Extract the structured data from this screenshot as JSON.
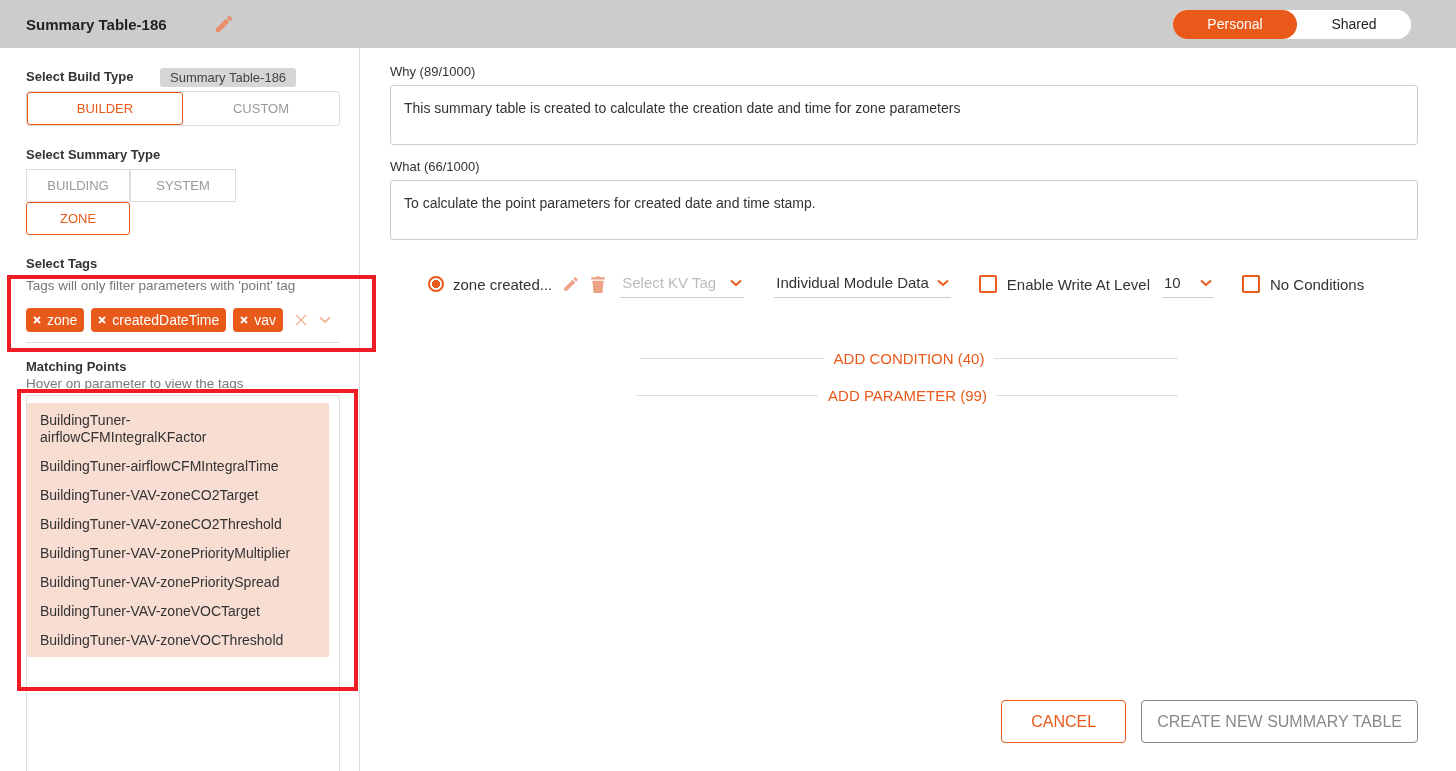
{
  "header": {
    "title": "Summary Table-186",
    "toggle": [
      {
        "label": "Personal",
        "selected": true
      },
      {
        "label": "Shared",
        "selected": false
      }
    ]
  },
  "tooltip": "Summary Table-186",
  "build_type": {
    "label": "Select Build Type",
    "options": [
      {
        "label": "BUILDER",
        "selected": true
      },
      {
        "label": "CUSTOM",
        "selected": false
      }
    ]
  },
  "summary_type": {
    "label": "Select Summary Type",
    "options": [
      {
        "label": "BUILDING",
        "selected": false
      },
      {
        "label": "SYSTEM",
        "selected": false
      },
      {
        "label": "ZONE",
        "selected": true
      }
    ]
  },
  "tags": {
    "label": "Select Tags",
    "hint": "Tags will only filter parameters with 'point' tag",
    "chips": [
      "zone",
      "createdDateTime",
      "vav"
    ],
    "highlighted": true
  },
  "matching": {
    "label": "Matching Points",
    "hint": "Hover on parameter to view the tags",
    "highlighted": true,
    "points": [
      "BuildingTuner-airflowCFMIntegralKFactor",
      "BuildingTuner-airflowCFMIntegralTime",
      "BuildingTuner-VAV-zoneCO2Target",
      "BuildingTuner-VAV-zoneCO2Threshold",
      "BuildingTuner-VAV-zonePriorityMultiplier",
      "BuildingTuner-VAV-zonePrioritySpread",
      "BuildingTuner-VAV-zoneVOCTarget",
      "BuildingTuner-VAV-zoneVOCThreshold"
    ]
  },
  "why": {
    "label": "Why (89/1000)",
    "value": "This summary table is created to calculate the creation date and time for zone parameters"
  },
  "what": {
    "label": "What (66/1000)",
    "value": "To calculate the point parameters for created date and time stamp."
  },
  "parameter": {
    "selected": true,
    "name": "zone created...",
    "kv_placeholder": "Select KV Tag",
    "data_type": "Individual Module Data",
    "enable_write": {
      "label": "Enable Write At Level",
      "checked": false
    },
    "level_value": "10",
    "no_conditions": {
      "label": "No Conditions",
      "checked": false
    }
  },
  "add_condition": "ADD CONDITION (40)",
  "add_parameter": "ADD PARAMETER (99)",
  "buttons": [
    {
      "label": "CANCEL",
      "kind": "cancel"
    },
    {
      "label": "CREATE NEW SUMMARY TABLE",
      "kind": "create"
    }
  ]
}
